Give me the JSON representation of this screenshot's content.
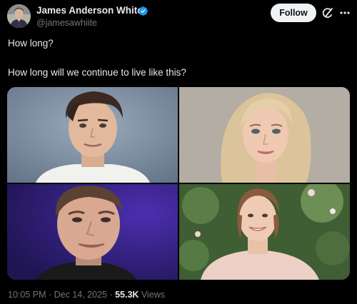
{
  "author": {
    "name": "James Anderson White",
    "handle": "@jamesawhiite",
    "verified": true,
    "avatar_icon": "profile-avatar"
  },
  "actions": {
    "follow_label": "Follow",
    "grok_icon": "grok-icon",
    "more_icon": "more-options-icon"
  },
  "post": {
    "line1": "How long?",
    "line2": "How long will we continue to live like this?"
  },
  "media": {
    "photos": [
      "portrait-young-man",
      "portrait-blonde-woman",
      "portrait-man-speaking",
      "portrait-young-woman-outdoors"
    ]
  },
  "meta": {
    "time": "10:05 PM",
    "sep1": " · ",
    "date": "Dec 14, 2025",
    "sep2": " · ",
    "views_count": "55.3K",
    "views_label": " Views"
  },
  "colors": {
    "background": "#000000",
    "text": "#e7e9ea",
    "muted": "#71767b",
    "verified_blue": "#1d9bf0",
    "follow_bg": "#eff3f4"
  }
}
